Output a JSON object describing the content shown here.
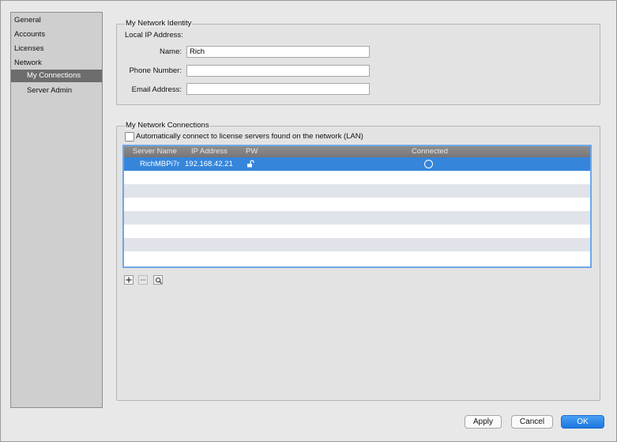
{
  "sidebar": {
    "items": [
      {
        "label": "General"
      },
      {
        "label": "Accounts"
      },
      {
        "label": "Licenses"
      },
      {
        "label": "Network"
      },
      {
        "label": "My Connections"
      },
      {
        "label": "Server Admin"
      }
    ],
    "selected": "My Connections"
  },
  "identity": {
    "title": "My Network Identity",
    "local_ip_label": "Local IP Address:",
    "name_label": "Name:",
    "name_value": "Rich",
    "phone_label": "Phone Number:",
    "phone_value": "",
    "email_label": "Email Address:",
    "email_value": ""
  },
  "connections": {
    "title": "My Network Connections",
    "auto_connect_label": "Automatically connect to license servers found on the network (LAN)",
    "auto_connect_checked": false,
    "columns": {
      "server_name": "Server Name",
      "ip_address": "IP Address",
      "pw": "PW",
      "connected": "Connected"
    },
    "rows": [
      {
        "server_name": "RichMBPi7r",
        "ip_address": "192.168.42.21",
        "pw_icon": "unlock-icon",
        "connected": false
      }
    ]
  },
  "toolbar": {
    "add_icon": "plus-icon",
    "remove_icon": "minus-icon",
    "refresh_icon": "refresh-icon"
  },
  "buttons": {
    "apply": "Apply",
    "cancel": "Cancel",
    "ok": "OK"
  },
  "colors": {
    "selection": "#3586db",
    "ok_button": "#1b76e0",
    "focus_ring": "#6da7e8"
  }
}
